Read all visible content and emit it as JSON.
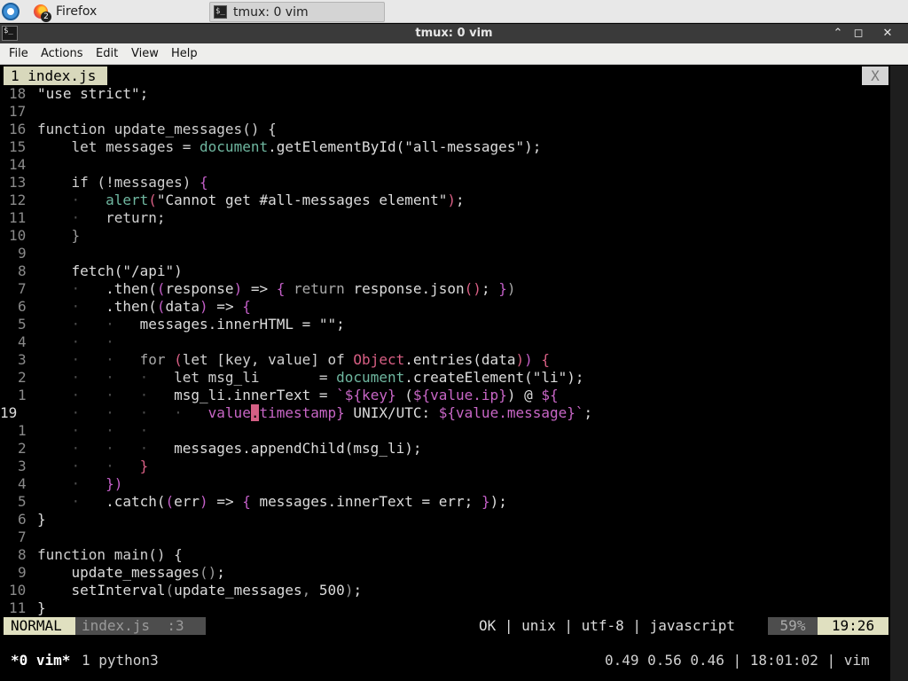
{
  "taskbar": {
    "tasks": [
      {
        "label": "Firefox",
        "badge": "2"
      },
      {
        "label": "tmux: 0 vim"
      }
    ]
  },
  "window": {
    "title": "tmux: 0 vim",
    "controls": {
      "minimize": "⌃",
      "maximize": "◻",
      "close": "✕"
    }
  },
  "menubar": {
    "items": [
      "File",
      "Actions",
      "Edit",
      "View",
      "Help"
    ]
  },
  "tabline": {
    "active_tab": "1 index.js",
    "close_label": "X"
  },
  "editor": {
    "lines": [
      {
        "num": "18",
        "segs": [
          {
            "t": "\"use strict\";",
            "c": "str"
          }
        ]
      },
      {
        "num": "17",
        "segs": []
      },
      {
        "num": "16",
        "segs": [
          {
            "t": "function update_messages() {",
            "c": "kw"
          }
        ]
      },
      {
        "num": "15",
        "segs": [
          {
            "t": "    let messages = ",
            "c": "kw"
          },
          {
            "t": "document",
            "c": "obj"
          },
          {
            "t": ".getElementById(",
            "c": "fn"
          },
          {
            "t": "\"all-messages\"",
            "c": "str"
          },
          {
            "t": ");",
            "c": "fn"
          }
        ]
      },
      {
        "num": "14",
        "segs": []
      },
      {
        "num": "13",
        "segs": [
          {
            "t": "    if (!messages) ",
            "c": "kw"
          },
          {
            "t": "{",
            "c": "p2"
          }
        ]
      },
      {
        "num": "12",
        "segs": [
          {
            "t": "    ·   ",
            "c": "ind"
          },
          {
            "t": "alert",
            "c": "obj"
          },
          {
            "t": "(",
            "c": "p1"
          },
          {
            "t": "\"Cannot get #all-messages element\"",
            "c": "str"
          },
          {
            "t": ")",
            "c": "p1"
          },
          {
            "t": ";",
            "c": "fn"
          }
        ]
      },
      {
        "num": "11",
        "segs": [
          {
            "t": "    ·   ",
            "c": "ind"
          },
          {
            "t": "return;",
            "c": "kw"
          }
        ]
      },
      {
        "num": "10",
        "segs": [
          {
            "t": "    }",
            "c": "dim"
          }
        ]
      },
      {
        "num": "9",
        "segs": []
      },
      {
        "num": "8",
        "segs": [
          {
            "t": "    fetch(",
            "c": "fn"
          },
          {
            "t": "\"/api\"",
            "c": "str"
          },
          {
            "t": ")",
            "c": "fn"
          }
        ]
      },
      {
        "num": "7",
        "segs": [
          {
            "t": "    ·   ",
            "c": "ind"
          },
          {
            "t": ".then(",
            "c": "fn"
          },
          {
            "t": "(",
            "c": "p2"
          },
          {
            "t": "response",
            "c": "fn"
          },
          {
            "t": ")",
            "c": "p2"
          },
          {
            "t": " => ",
            "c": "fn"
          },
          {
            "t": "{",
            "c": "p2"
          },
          {
            "t": " return ",
            "c": "gray"
          },
          {
            "t": "response.json",
            "c": "fn"
          },
          {
            "t": "()",
            "c": "p1"
          },
          {
            "t": "; ",
            "c": "fn"
          },
          {
            "t": "}",
            "c": "p2"
          },
          {
            "t": ")",
            "c": "gray"
          }
        ]
      },
      {
        "num": "6",
        "segs": [
          {
            "t": "    ·   ",
            "c": "ind"
          },
          {
            "t": ".then(",
            "c": "fn"
          },
          {
            "t": "(",
            "c": "p2"
          },
          {
            "t": "data",
            "c": "fn"
          },
          {
            "t": ")",
            "c": "p2"
          },
          {
            "t": " => ",
            "c": "fn"
          },
          {
            "t": "{",
            "c": "p2"
          }
        ]
      },
      {
        "num": "5",
        "segs": [
          {
            "t": "    ·   ·   ",
            "c": "ind"
          },
          {
            "t": "messages.innerHTML = ",
            "c": "fn"
          },
          {
            "t": "\"\"",
            "c": "str"
          },
          {
            "t": ";",
            "c": "fn"
          }
        ]
      },
      {
        "num": "4",
        "segs": [
          {
            "t": "    ·   ·",
            "c": "ind"
          }
        ]
      },
      {
        "num": "3",
        "segs": [
          {
            "t": "    ·   ·   ",
            "c": "ind"
          },
          {
            "t": "for ",
            "c": "gray"
          },
          {
            "t": "(",
            "c": "p1"
          },
          {
            "t": "let [key, value] of ",
            "c": "kw"
          },
          {
            "t": "Object",
            "c": "p1"
          },
          {
            "t": ".entries(",
            "c": "fn"
          },
          {
            "t": "data",
            "c": "fn"
          },
          {
            "t": ")",
            "c": "p1"
          },
          {
            "t": ")",
            "c": "p2"
          },
          {
            "t": " {",
            "c": "p1"
          }
        ]
      },
      {
        "num": "2",
        "segs": [
          {
            "t": "    ·   ·   ·   ",
            "c": "ind"
          },
          {
            "t": "let msg_li       = ",
            "c": "kw"
          },
          {
            "t": "document",
            "c": "obj"
          },
          {
            "t": ".createElement(",
            "c": "fn"
          },
          {
            "t": "\"li\"",
            "c": "str"
          },
          {
            "t": ");",
            "c": "fn"
          }
        ]
      },
      {
        "num": "1",
        "segs": [
          {
            "t": "    ·   ·   ·   ",
            "c": "ind"
          },
          {
            "t": "msg_li.innerText = ",
            "c": "fn"
          },
          {
            "t": "`${key}",
            "c": "tmpl"
          },
          {
            "t": " (",
            "c": "fn"
          },
          {
            "t": "${value.ip}",
            "c": "tmpl"
          },
          {
            "t": ") @ ",
            "c": "fn"
          },
          {
            "t": "${",
            "c": "tmpl"
          }
        ]
      },
      {
        "num": "19",
        "current": true,
        "segs": [
          {
            "t": "    ·   ·   ·   ·   ",
            "c": "ind"
          },
          {
            "t": "value",
            "c": "tmpl"
          },
          {
            "t": ".",
            "c": "cursor"
          },
          {
            "t": "timestamp}",
            "c": "tmpl"
          },
          {
            "t": " UNIX/UTC: ",
            "c": "fn"
          },
          {
            "t": "${value.message}`",
            "c": "tmpl"
          },
          {
            "t": ";",
            "c": "fn"
          }
        ]
      },
      {
        "num": "1",
        "segs": [
          {
            "t": "    ·   ·   ·",
            "c": "ind"
          }
        ]
      },
      {
        "num": "2",
        "segs": [
          {
            "t": "    ·   ·   ·   ",
            "c": "ind"
          },
          {
            "t": "messages.appendChild(msg_li);",
            "c": "fn"
          }
        ]
      },
      {
        "num": "3",
        "segs": [
          {
            "t": "    ·   ·   ",
            "c": "ind"
          },
          {
            "t": "}",
            "c": "p1"
          }
        ]
      },
      {
        "num": "4",
        "segs": [
          {
            "t": "    ·   ",
            "c": "ind"
          },
          {
            "t": "})",
            "c": "p2"
          }
        ]
      },
      {
        "num": "5",
        "segs": [
          {
            "t": "    ·   ",
            "c": "ind"
          },
          {
            "t": ".catch(",
            "c": "fn"
          },
          {
            "t": "(",
            "c": "p2"
          },
          {
            "t": "err",
            "c": "fn"
          },
          {
            "t": ")",
            "c": "p2"
          },
          {
            "t": " => ",
            "c": "fn"
          },
          {
            "t": "{",
            "c": "p2"
          },
          {
            "t": " messages.innerText = err; ",
            "c": "fn"
          },
          {
            "t": "}",
            "c": "p2"
          },
          {
            "t": ");",
            "c": "fn"
          }
        ]
      },
      {
        "num": "6",
        "segs": [
          {
            "t": "}",
            "c": "fn"
          }
        ]
      },
      {
        "num": "7",
        "segs": []
      },
      {
        "num": "8",
        "segs": [
          {
            "t": "function main() {",
            "c": "kw"
          }
        ]
      },
      {
        "num": "9",
        "segs": [
          {
            "t": "    update_messages",
            "c": "fn"
          },
          {
            "t": "()",
            "c": "dim"
          },
          {
            "t": ";",
            "c": "fn"
          }
        ]
      },
      {
        "num": "10",
        "segs": [
          {
            "t": "    setInterval",
            "c": "fn"
          },
          {
            "t": "(",
            "c": "dim"
          },
          {
            "t": "update_messages",
            "c": "fn"
          },
          {
            "t": ", ",
            "c": "dim"
          },
          {
            "t": "500",
            "c": "fn"
          },
          {
            "t": ")",
            "c": "dim"
          },
          {
            "t": ";",
            "c": "fn"
          }
        ]
      },
      {
        "num": "11",
        "segs": [
          {
            "t": "}",
            "c": "fn"
          }
        ]
      }
    ]
  },
  "statusline": {
    "mode": "NORMAL",
    "file": "index.js  :3",
    "info": "OK | unix | utf-8 | javascript",
    "percent": "59%",
    "position": "19:26"
  },
  "tmux": {
    "active_window": "*0 vim*",
    "other_window": "1 python3",
    "right": "0.49 0.56 0.46 | 18:01:02 | vim"
  },
  "colors": {
    "keyword_paren": "#d85f84",
    "object_teal": "#6fb7a0",
    "template_magenta": "#c866c6",
    "status_accent": "#e0e0c0"
  }
}
